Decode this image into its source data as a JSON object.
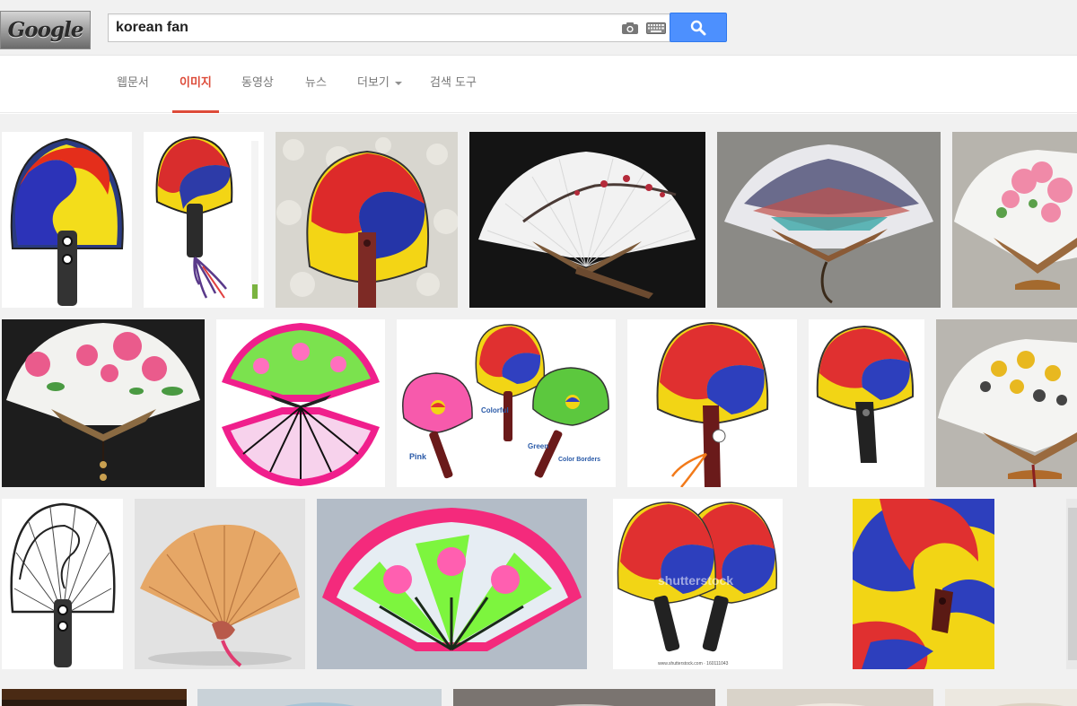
{
  "logo": {
    "text": "Google"
  },
  "search": {
    "query": "korean fan"
  },
  "icons": {
    "camera": "camera-icon",
    "keyboard": "keyboard-icon",
    "search": "search-icon"
  },
  "tabs": [
    {
      "label": "웹문서",
      "active": false
    },
    {
      "label": "이미지",
      "active": true
    },
    {
      "label": "동영상",
      "active": false
    },
    {
      "label": "뉴스",
      "active": false
    },
    {
      "label": "더보기",
      "active": false,
      "dropdown": true
    },
    {
      "label": "검색 도구",
      "active": false
    }
  ],
  "colors": {
    "accent": "#dd4b39",
    "search_button": "#4d90fe"
  },
  "results": {
    "thumb_captions": {
      "pink": "Pink",
      "colorful": "Colorful",
      "green": "Green",
      "color_borders": "Color Borders",
      "watermark": "shutterstock",
      "site": "www.shutterstock.com · 160111043"
    }
  }
}
